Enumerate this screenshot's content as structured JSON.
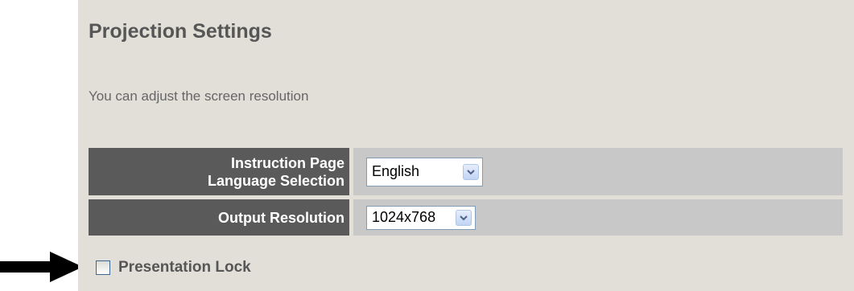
{
  "page": {
    "title": "Projection Settings",
    "description": "You can adjust the screen resolution"
  },
  "settings": {
    "language": {
      "label_line1": "Instruction Page",
      "label_line2": "Language Selection",
      "value": "English"
    },
    "resolution": {
      "label": "Output Resolution",
      "value": "1024x768"
    }
  },
  "presentation_lock": {
    "label": "Presentation Lock",
    "checked": false
  },
  "icons": {
    "dropdown": "chevron-down-icon",
    "pointer": "arrow-right-icon"
  },
  "colors": {
    "panel_bg": "#e2dfd9",
    "label_bg": "#5a5a5a",
    "value_bg": "#c8c8c8",
    "heading_text": "#565656"
  }
}
